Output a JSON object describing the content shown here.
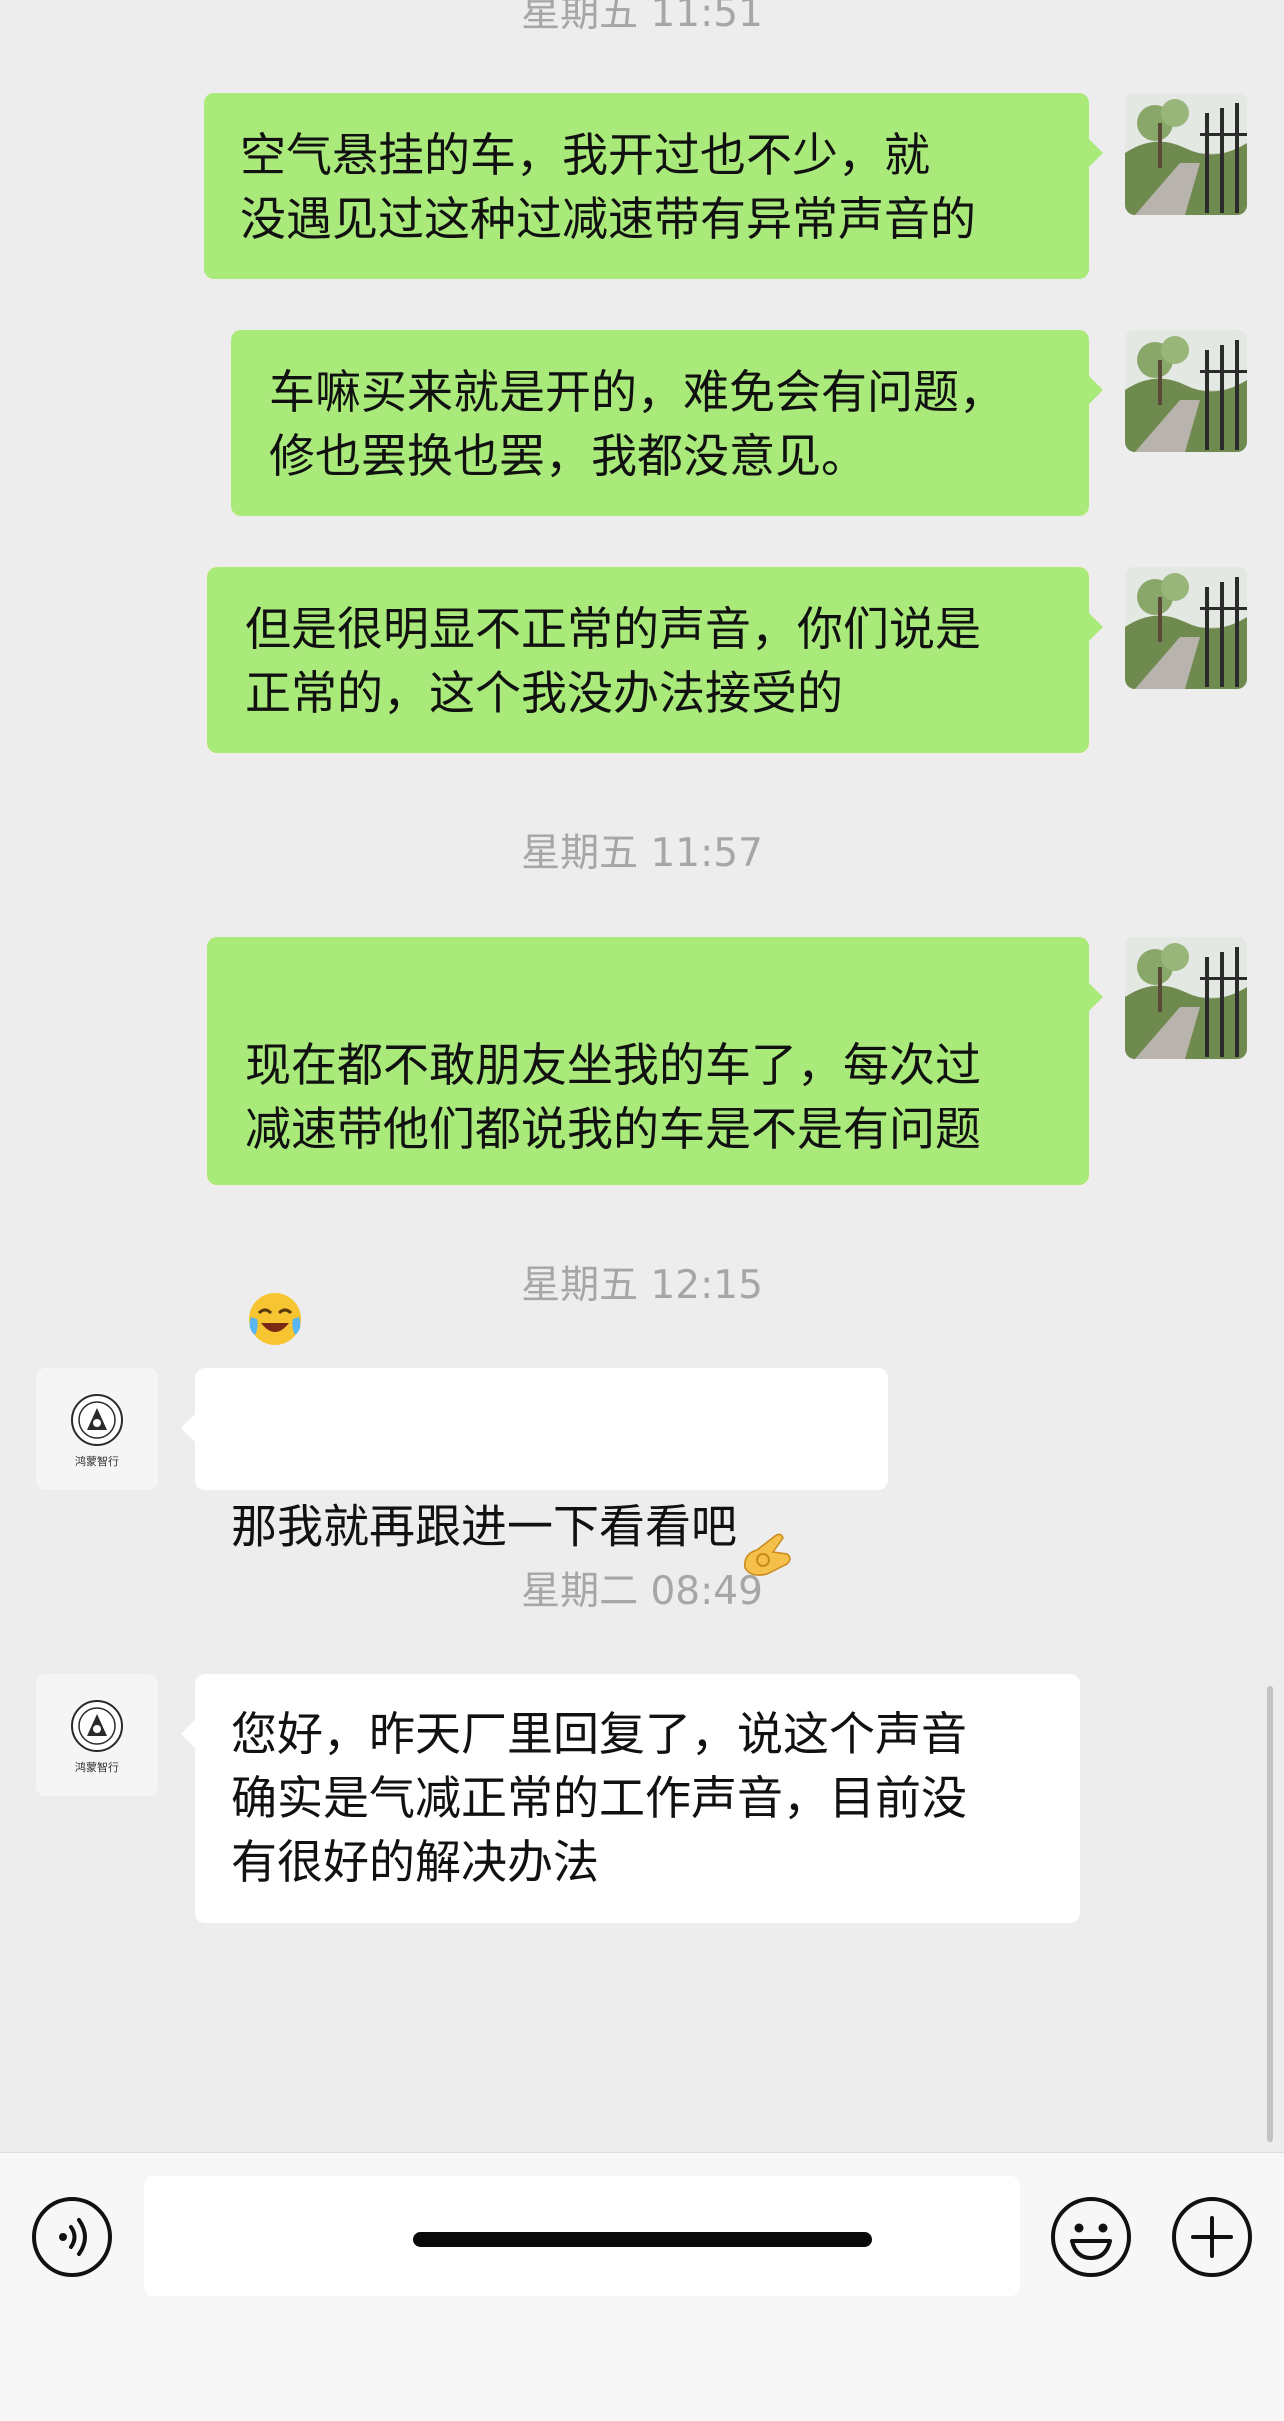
{
  "chat": {
    "messages": [
      {
        "type": "timestamp",
        "text": "星期五 11:51"
      },
      {
        "type": "outgoing",
        "text": "空气悬挂的车，我开过也不少，就从没遇见过这种过减速带有异常声音的"
      },
      {
        "type": "outgoing",
        "text": "车嘛买来就是开的，难免会有问题，修也罢换也罢，我都没意见。"
      },
      {
        "type": "outgoing",
        "text": "但是很明显不正常的声音，你们说是正常的，这个我没办法接受的"
      },
      {
        "type": "timestamp",
        "text": "星期五 11:57"
      },
      {
        "type": "outgoing",
        "text": "现在都不敢朋友坐我的车了，每次过减速带他们都说我的车是不是有问题",
        "emoji": "face-with-tears-of-joy"
      },
      {
        "type": "timestamp",
        "text": "星期五 12:15"
      },
      {
        "type": "incoming",
        "sender_brand": "鸿蒙智行",
        "text": "那我就再跟进一下看看吧",
        "emoji": "ok-hand"
      },
      {
        "type": "timestamp",
        "text": "星期二 08:49"
      },
      {
        "type": "incoming",
        "sender_brand": "鸿蒙智行",
        "text": "您好，昨天厂里回复了，说这个声音确实是气减正常的工作声音，目前没有很好的解决办法"
      }
    ],
    "ts1": "星期五 11:51",
    "ts2": "星期五 11:57",
    "ts3": "星期五 12:15",
    "ts4": "星期二 08:49",
    "msg1": "空气悬挂的车，我开过也不少，就\n没遇见过这种过减速带有异常声音的",
    "msg2": "车嘛买来就是开的，难免会有问题，\n修也罢换也罢，我都没意见。",
    "msg3": "但是很明显不正常的声音，你们说是\n正常的，这个我没办法接受的",
    "msg4": "现在都不敢朋友坐我的车了，每次过\n减速带他们都说我的车是不是有问题",
    "msg5": "那我就再跟进一下看看吧",
    "msg6": "您好，昨天厂里回复了，说这个声音\n确实是气减正常的工作声音，目前没\n有很好的解决办法",
    "contact_brand": "鸿蒙智行"
  },
  "input_bar": {
    "voice_icon": "voice-icon",
    "emoji_icon": "emoji-icon",
    "plus_icon": "plus-icon",
    "input_value": ""
  },
  "colors": {
    "background": "#ededed",
    "outgoing_bubble": "#a9ea7a",
    "incoming_bubble": "#ffffff",
    "timestamp": "#a6a6a6"
  }
}
